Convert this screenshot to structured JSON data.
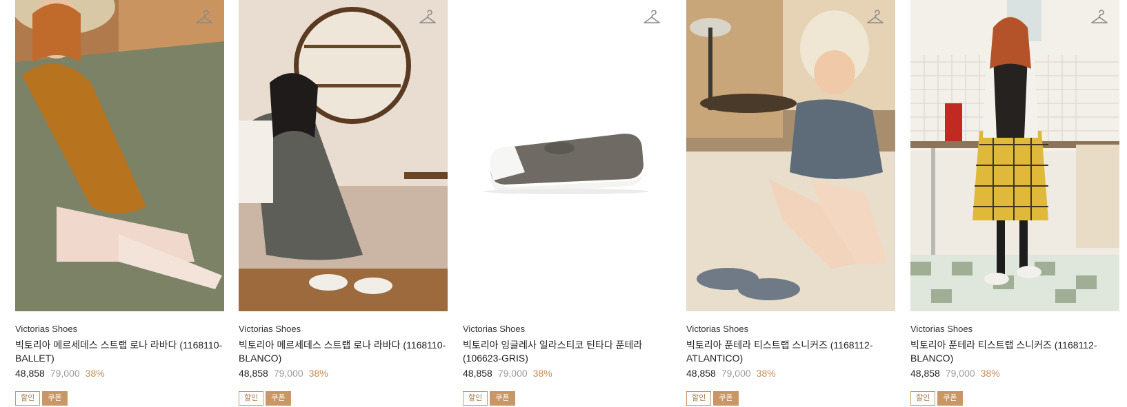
{
  "products": [
    {
      "brand": "Victorias Shoes",
      "name": "빅토리아 메르세데스 스트랩 로나 라바다 (1168110-BALLET)",
      "price": "48,858",
      "original_price": "79,000",
      "discount": "38%",
      "badges": [
        "할인",
        "쿠폰"
      ]
    },
    {
      "brand": "Victorias Shoes",
      "name": "빅토리아 메르세데스 스트랩 로나 라바다 (1168110-BLANCO)",
      "price": "48,858",
      "original_price": "79,000",
      "discount": "38%",
      "badges": [
        "할인",
        "쿠폰"
      ]
    },
    {
      "brand": "Victorias Shoes",
      "name": "빅토리아 잉글레사 일라스티코 틴타다 푼테라 (106623-GRIS)",
      "price": "48,858",
      "original_price": "79,000",
      "discount": "38%",
      "badges": [
        "할인",
        "쿠폰"
      ]
    },
    {
      "brand": "Victorias Shoes",
      "name": "빅토리아 푼테라 티스트랩 스니커즈 (1168112-ATLANTICO)",
      "price": "48,858",
      "original_price": "79,000",
      "discount": "38%",
      "badges": [
        "할인",
        "쿠폰"
      ]
    },
    {
      "brand": "Victorias Shoes",
      "name": "빅토리아 푼테라 티스트랩 스니커즈 (1168112-BLANCO)",
      "price": "48,858",
      "original_price": "79,000",
      "discount": "38%",
      "badges": [
        "할인",
        "쿠폰"
      ]
    }
  ],
  "icons": {
    "wishlist": "hanger-icon"
  },
  "colors": {
    "discount": "#c08e5a",
    "badge": "#c99765",
    "original_price": "#9a9a9a"
  }
}
